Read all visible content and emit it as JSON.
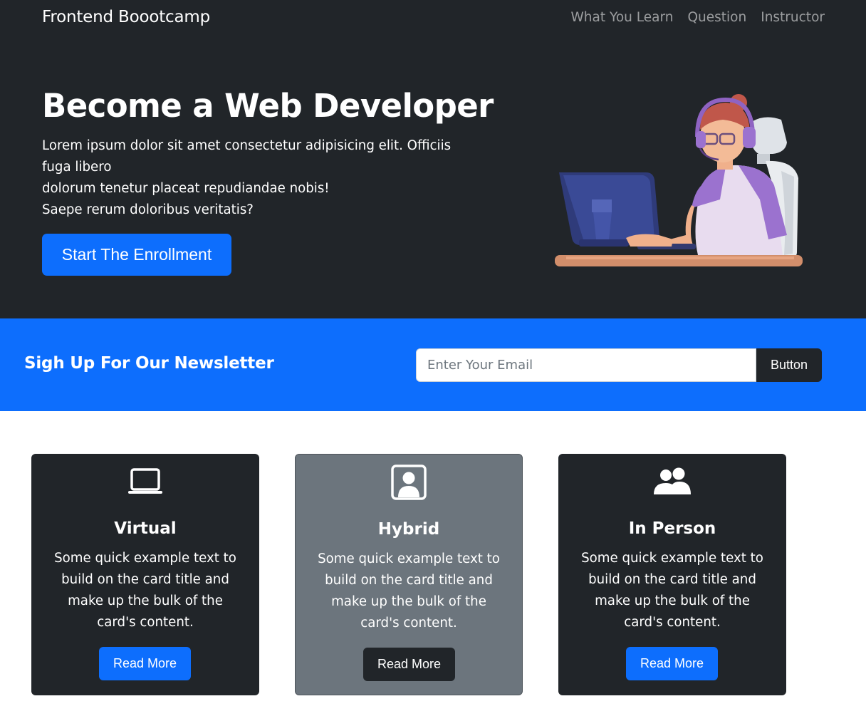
{
  "navbar": {
    "brand": "Frontend Boootcamp",
    "links": [
      "What You Learn",
      "Question",
      "Instructor"
    ]
  },
  "hero": {
    "title": "Become a Web Developer",
    "text_lines": [
      "Lorem ipsum dolor sit amet consectetur adipisicing elit. Officiis fuga libero",
      "dolorum tenetur placeat repudiandae nobis!",
      "Saepe rerum doloribus veritatis?"
    ],
    "button_label": "Start The Enrollment",
    "illustration": "developer-at-computer-illustration"
  },
  "newsletter": {
    "title": "Sigh Up For Our Newsletter",
    "input_placeholder": "Enter Your Email",
    "input_value": "",
    "button_label": "Button"
  },
  "cards": [
    {
      "icon": "laptop-icon",
      "title": "Virtual",
      "text": "Some quick example text to build on the card title and make up the bulk of the card's content.",
      "button_label": "Read More",
      "theme": "dark"
    },
    {
      "icon": "person-badge-icon",
      "title": "Hybrid",
      "text": "Some quick example text to build on the card title and make up the bulk of the card's content.",
      "button_label": "Read More",
      "theme": "gray"
    },
    {
      "icon": "people-icon",
      "title": "In Person",
      "text": "Some quick example text to build on the card title and make up the bulk of the card's content.",
      "button_label": "Read More",
      "theme": "dark"
    }
  ],
  "colors": {
    "dark": "#212529",
    "primary": "#0d6efd",
    "secondary": "#6c757d",
    "white": "#ffffff"
  }
}
